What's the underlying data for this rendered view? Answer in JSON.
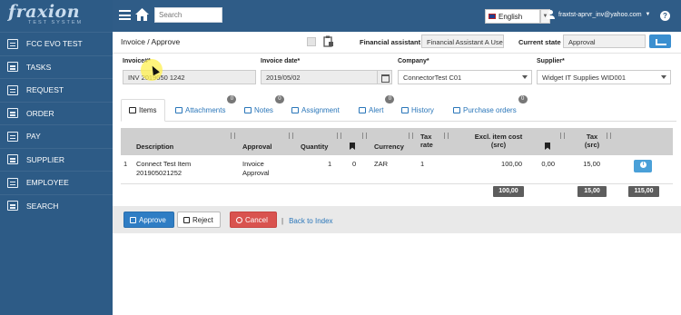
{
  "app": {
    "logo_text": "fraxion",
    "logo_sub": "TEST SYSTEM"
  },
  "sidebar": {
    "items": [
      {
        "label": "FCC EVO TEST",
        "icon": "list-icon"
      },
      {
        "label": "TASKS",
        "icon": "list-icon"
      },
      {
        "label": "REQUEST",
        "icon": "inbox-icon"
      },
      {
        "label": "ORDER",
        "icon": "cart-icon"
      },
      {
        "label": "PAY",
        "icon": "credit-card-icon"
      },
      {
        "label": "SUPPLIER",
        "icon": "grid-icon"
      },
      {
        "label": "EMPLOYEE",
        "icon": "id-card-icon"
      },
      {
        "label": "SEARCH",
        "icon": "search-icon"
      }
    ]
  },
  "topbar": {
    "search_placeholder": "Search",
    "language": "English",
    "user": "fraxtst-aprvr_inv@yahoo.com",
    "help": "?"
  },
  "header": {
    "breadcrumb": "Invoice / Approve",
    "financial_assistant_label": "Financial assistant",
    "financial_assistant_value": "Financial Assistant A Use",
    "current_state_label": "Current state",
    "current_state_value": "Approval"
  },
  "fields": {
    "invoice_label": "Invoice#*",
    "invoice_value": "INV 2019050 1242",
    "invoice_date_label": "Invoice date*",
    "invoice_date_value": "2019/05/02",
    "company_label": "Company*",
    "company_value": "ConnectorTest C01",
    "supplier_label": "Supplier*",
    "supplier_value": "Widget IT Supplies WID001"
  },
  "tabs": [
    {
      "label": "Items",
      "active": true
    },
    {
      "label": "Attachments",
      "badge": "0"
    },
    {
      "label": "Notes",
      "badge": "0"
    },
    {
      "label": "Assignment"
    },
    {
      "label": "Alert",
      "badge": "0"
    },
    {
      "label": "History"
    },
    {
      "label": "Purchase orders",
      "badge": "0"
    }
  ],
  "table": {
    "headers": {
      "description": "Description",
      "approval": "Approval",
      "quantity": "Quantity",
      "currency": "Currency",
      "tax_rate": "Tax rate",
      "excl_cost": "Excl. item cost (src)",
      "tax": "Tax (src)"
    },
    "rows": [
      {
        "num": "1",
        "description": "Connect Test Item 201905021252",
        "approval": "Invoice Approval",
        "quantity": "1",
        "flag_value": "0",
        "currency": "ZAR",
        "tax_rate": "1",
        "excl_cost": "100,00",
        "flag_amount": "0,00",
        "tax": "15,00"
      }
    ],
    "totals": {
      "excl_cost": "100,00",
      "tax": "15,00",
      "grand": "115,00"
    }
  },
  "footer": {
    "approve": "Approve",
    "reject": "Reject",
    "cancel": "Cancel",
    "back": "Back to Index"
  },
  "colors": {
    "sidebar": "#2d5b86",
    "topbar": "#2f5c87",
    "primary": "#2f7dc4",
    "danger": "#d9534f",
    "info": "#4aa0d8"
  }
}
